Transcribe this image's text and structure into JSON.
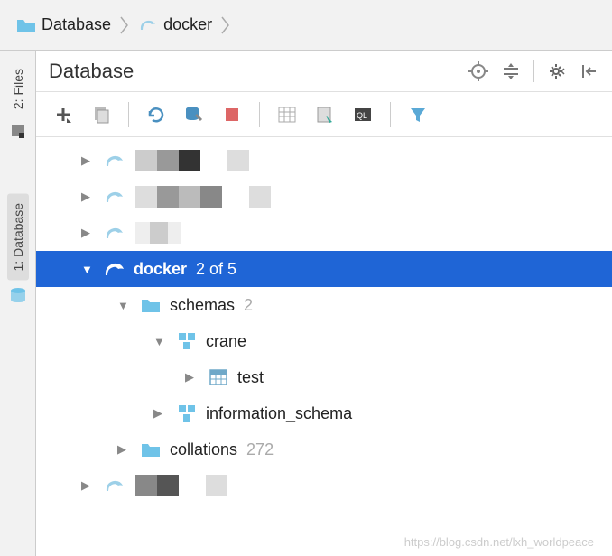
{
  "breadcrumb": {
    "root": "Database",
    "current": "docker"
  },
  "left_tabs": {
    "files": "2: Files",
    "database": "1: Database"
  },
  "panel": {
    "title": "Database"
  },
  "tree": {
    "selected": {
      "name": "docker",
      "count": "2 of 5"
    },
    "schemas": {
      "label": "schemas",
      "count": "2",
      "children": {
        "crane": "crane",
        "test": "test",
        "info_schema": "information_schema"
      }
    },
    "collations": {
      "label": "collations",
      "count": "272"
    }
  },
  "watermark": "https://blog.csdn.net/lxh_worldpeace"
}
